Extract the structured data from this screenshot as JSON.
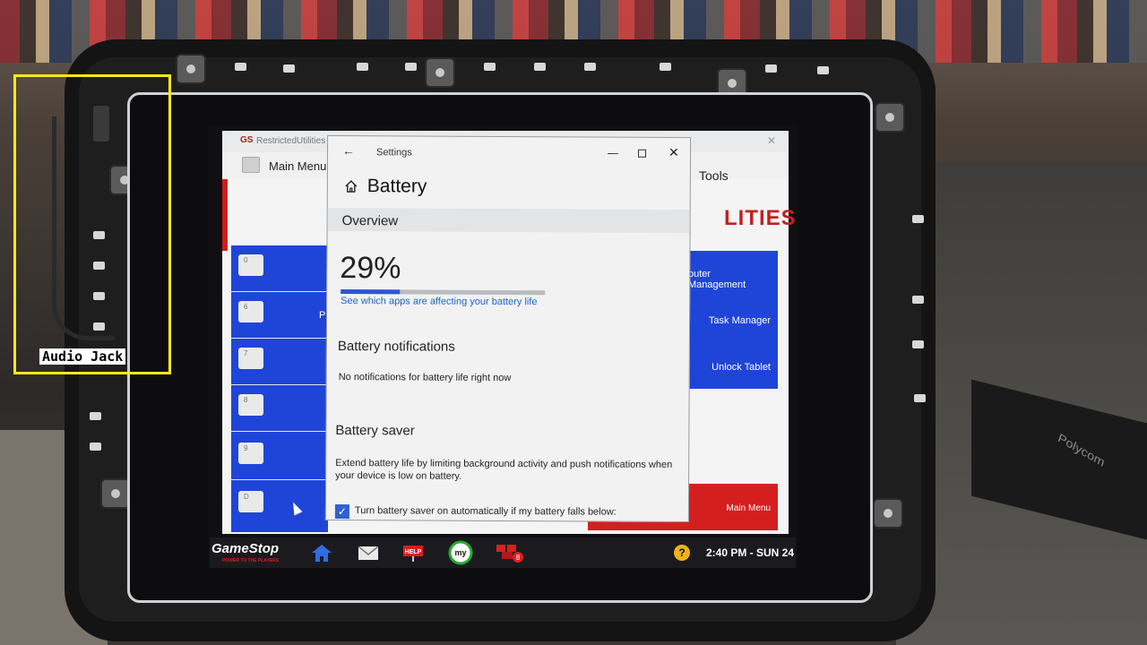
{
  "annotation": {
    "label": "Audio Jack",
    "color": "#ffe81a"
  },
  "background": {
    "polycom_text": "Polycom"
  },
  "back_app": {
    "title": "RestrictedUtilities v5",
    "logo": "GS",
    "menu_label": "Main Menu",
    "tools_label": "Tools",
    "brand_partial": "LITIES",
    "left_keys": [
      "0",
      "6",
      "7",
      "8",
      "9",
      "D"
    ],
    "left_partial_text": "P",
    "right_items": [
      "puter Management",
      "Task Manager",
      "Unlock Tablet"
    ],
    "bottom_button": "Main Menu"
  },
  "settings": {
    "window_title": "Settings",
    "page_title": "Battery",
    "overview_heading": "Overview",
    "battery_percent": "29%",
    "battery_fill_fraction": 0.29,
    "apps_link": "See which apps are affecting your battery life",
    "notifications_heading": "Battery notifications",
    "notifications_text": "No notifications for battery life right now",
    "saver_heading": "Battery saver",
    "saver_text": "Extend battery life by limiting background activity and push notifications when your device is low on battery.",
    "saver_checkbox_label": "Turn battery saver on automatically if my battery falls below:",
    "saver_checkbox_checked": true
  },
  "taskbar": {
    "logo": "GameStop",
    "logo_tagline": "POWER TO THE PLAYERS",
    "icons": [
      "home-icon",
      "mail-icon",
      "help-sign-icon",
      "my-rewards-icon",
      "notifications-icon"
    ],
    "my_label": "my",
    "help_label": "HELP",
    "badge_count": "8",
    "help_button": "?",
    "clock": "2:40 PM - SUN 24"
  }
}
